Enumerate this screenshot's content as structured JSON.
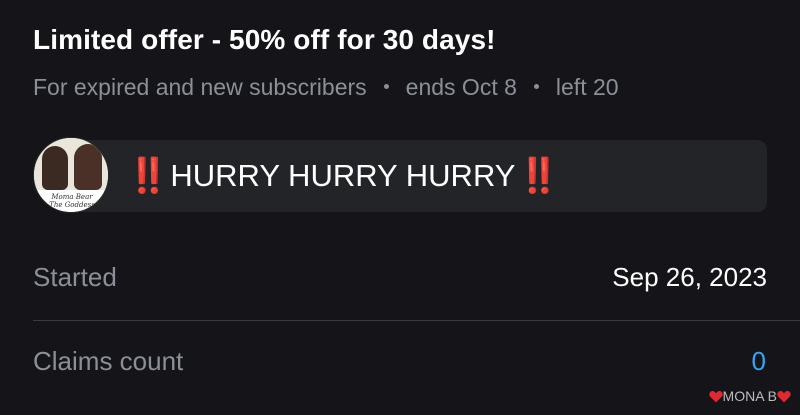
{
  "offer": {
    "title": "Limited offer - 50% off for 30 days!",
    "audience": "For expired and new subscribers",
    "ends": "ends Oct 8",
    "left": "left 20"
  },
  "message": {
    "prefix_emoji": "‼️",
    "text": "HURRY HURRY HURRY",
    "suffix_emoji": "‼️",
    "avatar_caption_line1": "Moma Bear",
    "avatar_caption_line2": "The Goddess"
  },
  "details": {
    "started_label": "Started",
    "started_value": "Sep 26, 2023",
    "claims_label": "Claims count",
    "claims_value": "0"
  },
  "watermark": {
    "text": "MONA B"
  },
  "colors": {
    "background": "#151419",
    "muted_text": "#8a8f98",
    "bubble": "#232427",
    "accent_blue": "#2ea8f0",
    "alert_red": "#e32b2b"
  }
}
